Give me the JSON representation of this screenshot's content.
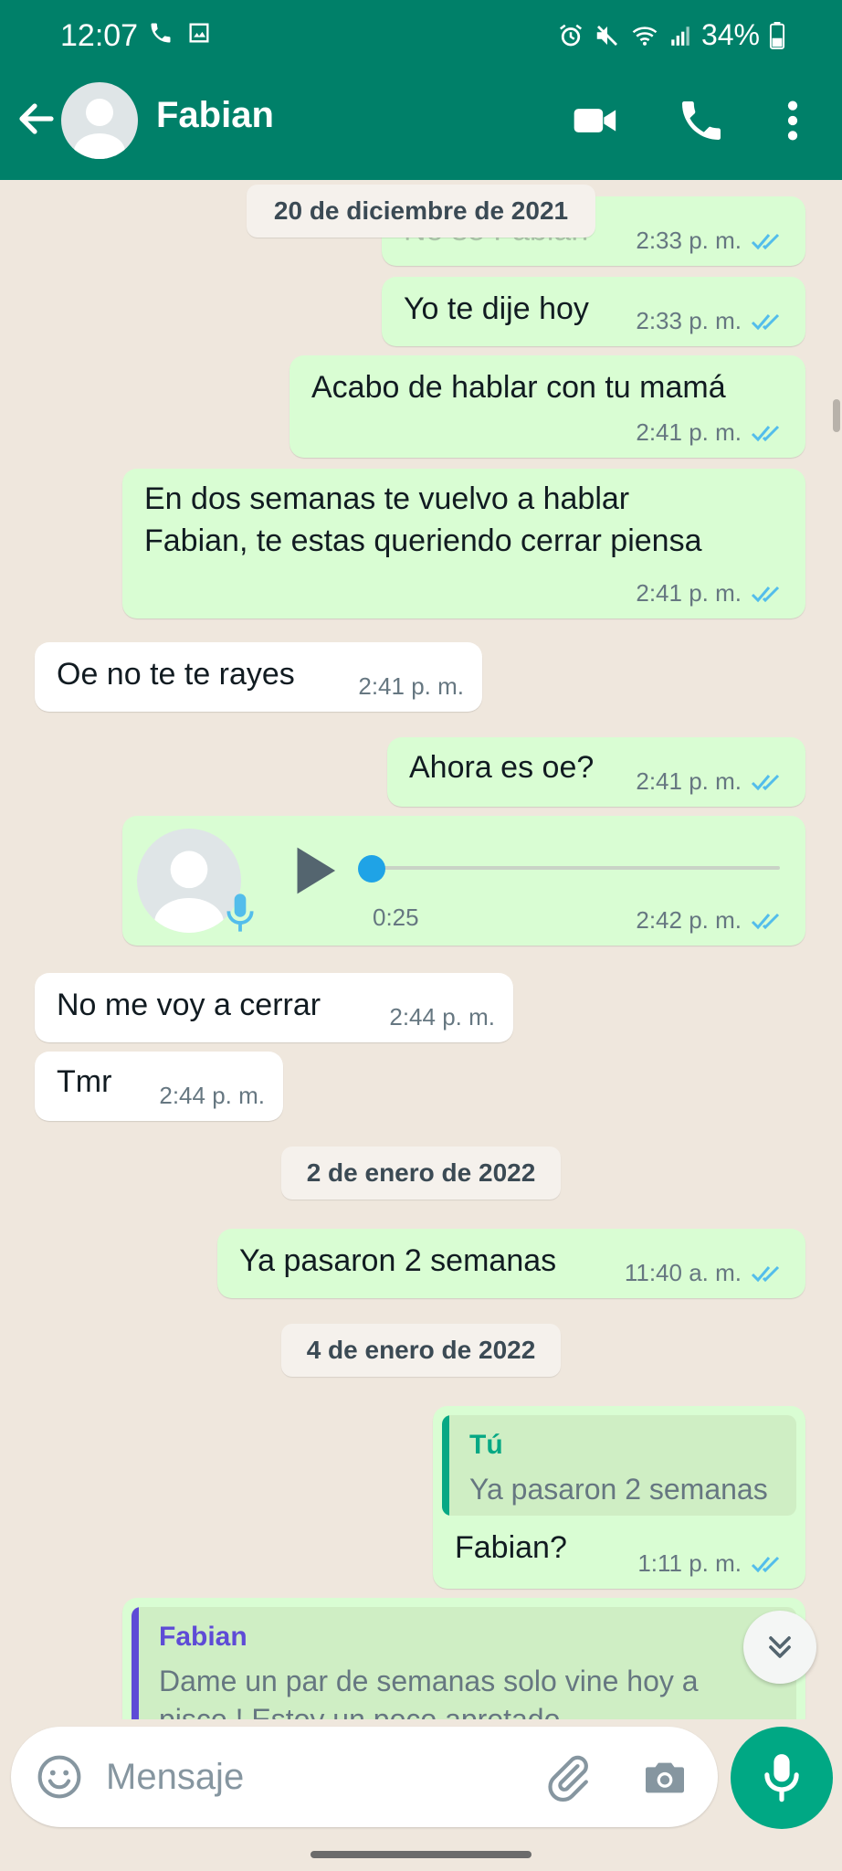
{
  "status": {
    "time": "12:07",
    "battery": "34%"
  },
  "header": {
    "contact_name": "Fabian"
  },
  "colors": {
    "header_bg": "#008069",
    "outgoing_bubble": "#d9fdd3",
    "incoming_bubble": "#ffffff",
    "read_tick": "#53bdeb",
    "fab": "#00a884"
  },
  "dates": [
    "20 de diciembre de 2021",
    "2 de enero de 2022",
    "4 de enero de 2022"
  ],
  "messages": [
    {
      "text": "No se Fabian",
      "time": "2:33 p. m."
    },
    {
      "text": "Yo te dije hoy",
      "time": "2:33 p. m."
    },
    {
      "text": "Acabo de hablar con tu mamá",
      "time": "2:41 p. m."
    },
    {
      "text": "En dos semanas te vuelvo a hablar\nFabian, te estas queriendo cerrar piensa",
      "time": "2:41 p. m."
    },
    {
      "text": "Oe no te te rayes",
      "time": "2:41 p. m."
    },
    {
      "text": "Ahora es oe?",
      "time": "2:41 p. m."
    },
    {
      "text": "",
      "duration": "0:25",
      "time": "2:42 p. m."
    },
    {
      "text": "No me voy a cerrar",
      "time": "2:44 p. m."
    },
    {
      "text": "Tmr",
      "time": "2:44 p. m."
    },
    {
      "text": "Ya pasaron 2 semanas",
      "time": "11:40 a. m."
    },
    {
      "text": "Fabian?",
      "time": "1:11 p. m.",
      "quote_author": "Tú",
      "quote_text": "Ya pasaron 2 semanas"
    },
    {
      "quote_author": "Fabian",
      "quote_text": "Dame un par de semanas solo vine hoy a\npisco ! Estoy un poco apretado"
    }
  ],
  "composer": {
    "placeholder": "Mensaje"
  },
  "icons": [
    "back-arrow-icon",
    "avatar-icon",
    "video-call-icon",
    "phone-icon",
    "more-vert-icon",
    "emoji-icon",
    "attach-icon",
    "camera-icon",
    "mic-icon",
    "chevron-double-down-icon",
    "play-icon"
  ]
}
